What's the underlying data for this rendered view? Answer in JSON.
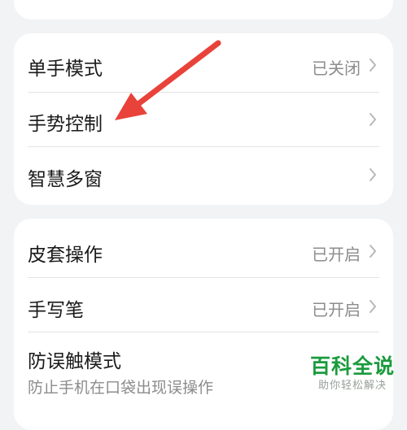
{
  "groups": [
    {
      "items": [
        {
          "title": "单手模式",
          "value": "已关闭"
        },
        {
          "title": "手势控制",
          "value": ""
        },
        {
          "title": "智慧多窗",
          "value": ""
        }
      ]
    },
    {
      "items": [
        {
          "title": "皮套操作",
          "value": "已开启"
        },
        {
          "title": "手写笔",
          "value": "已开启"
        },
        {
          "title": "防误触模式",
          "subtitle": "防止手机在口袋出现误操作",
          "value": ""
        }
      ]
    }
  ],
  "annotation": {
    "color": "#e8423a",
    "points_to": "手势控制"
  },
  "watermark": {
    "main": "百科全说",
    "sub": "助你轻松解决"
  },
  "colors": {
    "background": "#f1f3f5",
    "card": "#ffffff",
    "accent": "#1a9b3d"
  }
}
